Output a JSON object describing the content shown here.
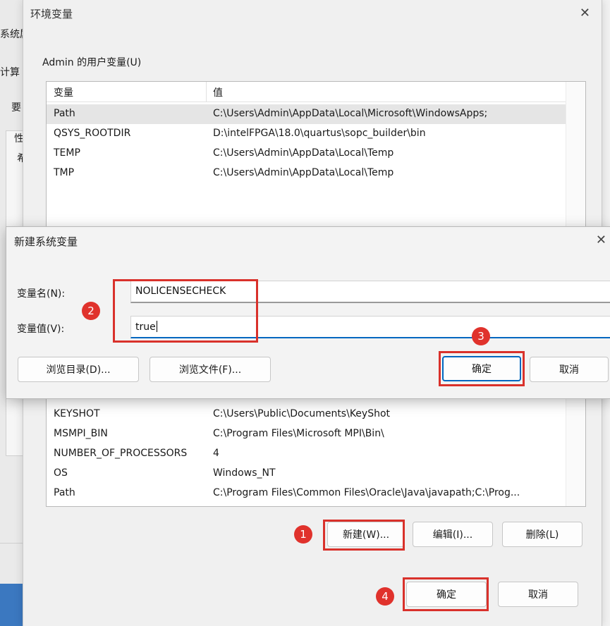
{
  "background_window": {
    "fragments": [
      "系统属",
      "计算",
      "要",
      "性",
      "希"
    ]
  },
  "env_dialog": {
    "title": "环境变量",
    "close_glyph": "✕",
    "user_group_label": "Admin 的用户变量(U)",
    "columns": [
      "变量",
      "值"
    ],
    "user_vars": [
      {
        "name": "Path",
        "value": "C:\\Users\\Admin\\AppData\\Local\\Microsoft\\WindowsApps;"
      },
      {
        "name": "QSYS_ROOTDIR",
        "value": "D:\\intelFPGA\\18.0\\quartus\\sopc_builder\\bin"
      },
      {
        "name": "TEMP",
        "value": "C:\\Users\\Admin\\AppData\\Local\\Temp"
      },
      {
        "name": "TMP",
        "value": "C:\\Users\\Admin\\AppData\\Local\\Temp"
      }
    ],
    "system_vars": [
      {
        "name": "KEYSHOT",
        "value": "C:\\Users\\Public\\Documents\\KeyShot"
      },
      {
        "name": "MSMPI_BIN",
        "value": "C:\\Program Files\\Microsoft MPI\\Bin\\"
      },
      {
        "name": "NUMBER_OF_PROCESSORS",
        "value": "4"
      },
      {
        "name": "OS",
        "value": "Windows_NT"
      },
      {
        "name": "Path",
        "value": "C:\\Program Files\\Common Files\\Oracle\\Java\\javapath;C:\\Prog..."
      }
    ],
    "system_buttons": {
      "new": "新建(W)...",
      "edit": "编辑(I)...",
      "delete": "删除(L)"
    },
    "ok": "确定",
    "cancel": "取消"
  },
  "new_var_dialog": {
    "title": "新建系统变量",
    "close_glyph": "✕",
    "name_label": "变量名(N):",
    "name_value": "NOLICENSECHECK",
    "value_label": "变量值(V):",
    "value_value": "true",
    "browse_dir": "浏览目录(D)...",
    "browse_file": "浏览文件(F)...",
    "ok": "确定",
    "cancel": "取消"
  },
  "annotations": [
    "1",
    "2",
    "3",
    "4"
  ],
  "colors": {
    "annotation_red": "#d9312b",
    "accent_blue": "#0067c0"
  }
}
